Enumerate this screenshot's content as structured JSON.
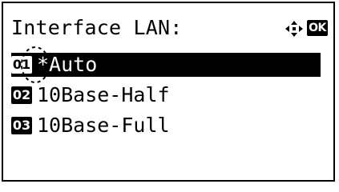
{
  "screen": {
    "title": "Interface LAN:",
    "nav_icon": "four-way-arrow-icon",
    "ok_label": "OK"
  },
  "menu": {
    "items": [
      {
        "number": "01",
        "label": "*Auto",
        "selected": true
      },
      {
        "number": "02",
        "label": "10Base-Half",
        "selected": false
      },
      {
        "number": "03",
        "label": "10Base-Full",
        "selected": false
      }
    ]
  },
  "colors": {
    "foreground": "#000000",
    "background": "#ffffff"
  }
}
